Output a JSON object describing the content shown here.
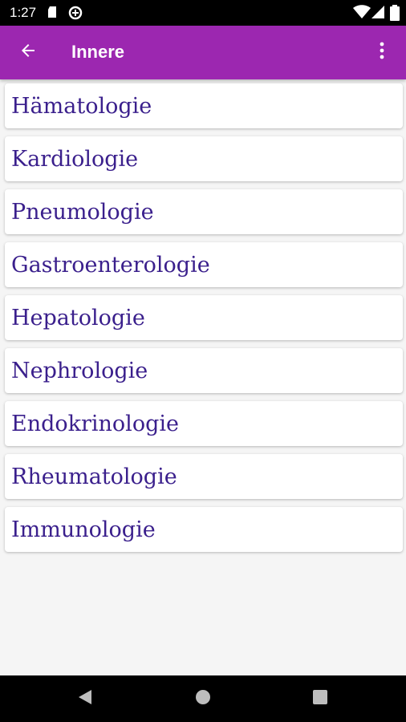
{
  "status_bar": {
    "time": "1:27",
    "icons": [
      "sd-card-icon",
      "data-saver-icon",
      "wifi-icon",
      "signal-icon",
      "battery-icon"
    ]
  },
  "app_bar": {
    "title": "Innere",
    "background_color": "#9c27b0",
    "back_icon": "arrow-left-icon",
    "menu_icon": "more-vert-icon"
  },
  "items": [
    {
      "label": "Hämatologie"
    },
    {
      "label": "Kardiologie"
    },
    {
      "label": "Pneumologie"
    },
    {
      "label": "Gastroenterologie"
    },
    {
      "label": "Hepatologie"
    },
    {
      "label": "Nephrologie"
    },
    {
      "label": "Endokrinologie"
    },
    {
      "label": "Rheumatologie"
    },
    {
      "label": "Immunologie"
    }
  ],
  "text_color": "#3a1f8c",
  "nav_bar": {
    "buttons": [
      "back-triangle-icon",
      "home-circle-icon",
      "recents-square-icon"
    ]
  }
}
